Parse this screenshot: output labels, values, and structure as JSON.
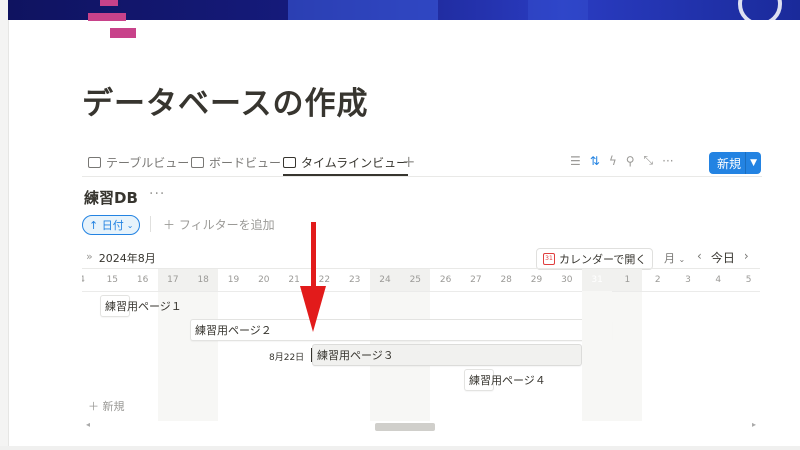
{
  "page": {
    "title": "データベースの作成",
    "accent_color": "#2383e2",
    "today_color": "#d44c47",
    "arrow_color": "#e21b1b"
  },
  "views": {
    "tabs": [
      {
        "label": "テーブルビュー",
        "icon": "table-icon"
      },
      {
        "label": "ボードビュー",
        "icon": "board-icon"
      },
      {
        "label": "タイムラインビュー",
        "icon": "timeline-icon",
        "active": true
      }
    ],
    "add": "+",
    "new_button": "新規"
  },
  "toolbar": {
    "icons": [
      "filter-icon",
      "sort-icon",
      "automation-icon",
      "search-icon",
      "expand-icon",
      "more-icon"
    ]
  },
  "database": {
    "title": "練習DB",
    "more": "···",
    "sort_label": "↑ 日付",
    "filter_add": "＋ フィルターを追加"
  },
  "timeline": {
    "collapse": "»",
    "month_label": "2024年8月",
    "calendar_button": "カレンダーで開く",
    "calendar_icon_text": "31",
    "zoom_label": "月",
    "today_label": "今日",
    "prev": "‹",
    "next": "›",
    "days": [
      {
        "d": "4"
      },
      {
        "d": "15"
      },
      {
        "d": "16"
      },
      {
        "d": "17",
        "wk": true
      },
      {
        "d": "18",
        "wk": true
      },
      {
        "d": "19"
      },
      {
        "d": "20"
      },
      {
        "d": "21"
      },
      {
        "d": "22"
      },
      {
        "d": "23"
      },
      {
        "d": "24",
        "wk": true
      },
      {
        "d": "25",
        "wk": true
      },
      {
        "d": "26"
      },
      {
        "d": "27"
      },
      {
        "d": "28"
      },
      {
        "d": "29"
      },
      {
        "d": "30"
      },
      {
        "d": "31",
        "wk": true,
        "today": true
      },
      {
        "d": "1",
        "wk": true
      },
      {
        "d": "2"
      },
      {
        "d": "3"
      },
      {
        "d": "4"
      },
      {
        "d": "5"
      }
    ],
    "items": [
      {
        "label": "練習用ページ１"
      },
      {
        "label": "練習用ページ２"
      },
      {
        "label": "練習用ページ３",
        "date_label": "8月22日"
      },
      {
        "label": "練習用ページ４"
      }
    ],
    "add_new": "＋ 新規"
  }
}
